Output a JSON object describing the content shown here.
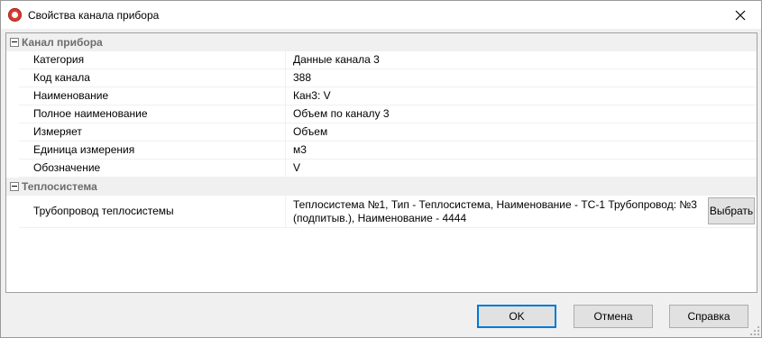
{
  "window": {
    "title": "Свойства канала прибора"
  },
  "categories": [
    {
      "label": "Канал прибора",
      "properties": [
        {
          "name": "Категория",
          "value": "Данные канала 3"
        },
        {
          "name": "Код канала",
          "value": "388"
        },
        {
          "name": "Наименование",
          "value": "Кан3: V"
        },
        {
          "name": "Полное наименование",
          "value": "Объем по каналу 3"
        },
        {
          "name": "Измеряет",
          "value": "Объем"
        },
        {
          "name": "Единица измерения",
          "value": "м3"
        },
        {
          "name": "Обозначение",
          "value": "V"
        }
      ]
    },
    {
      "label": "Теплосистема",
      "properties": [
        {
          "name": "Трубопровод теплосистемы",
          "value": "Теплосистема №1, Тип - Теплосистема, Наименование - ТС-1 Трубопровод: №3 (подпитыв.), Наименование - 4444",
          "button_label": "Выбрать"
        }
      ]
    }
  ],
  "buttons": {
    "ok": "OK",
    "cancel": "Отмена",
    "help": "Справка"
  },
  "colors": {
    "category_text": "#6d6d6d",
    "default_button_border": "#0078d7",
    "app_icon": "#d83b2e"
  }
}
